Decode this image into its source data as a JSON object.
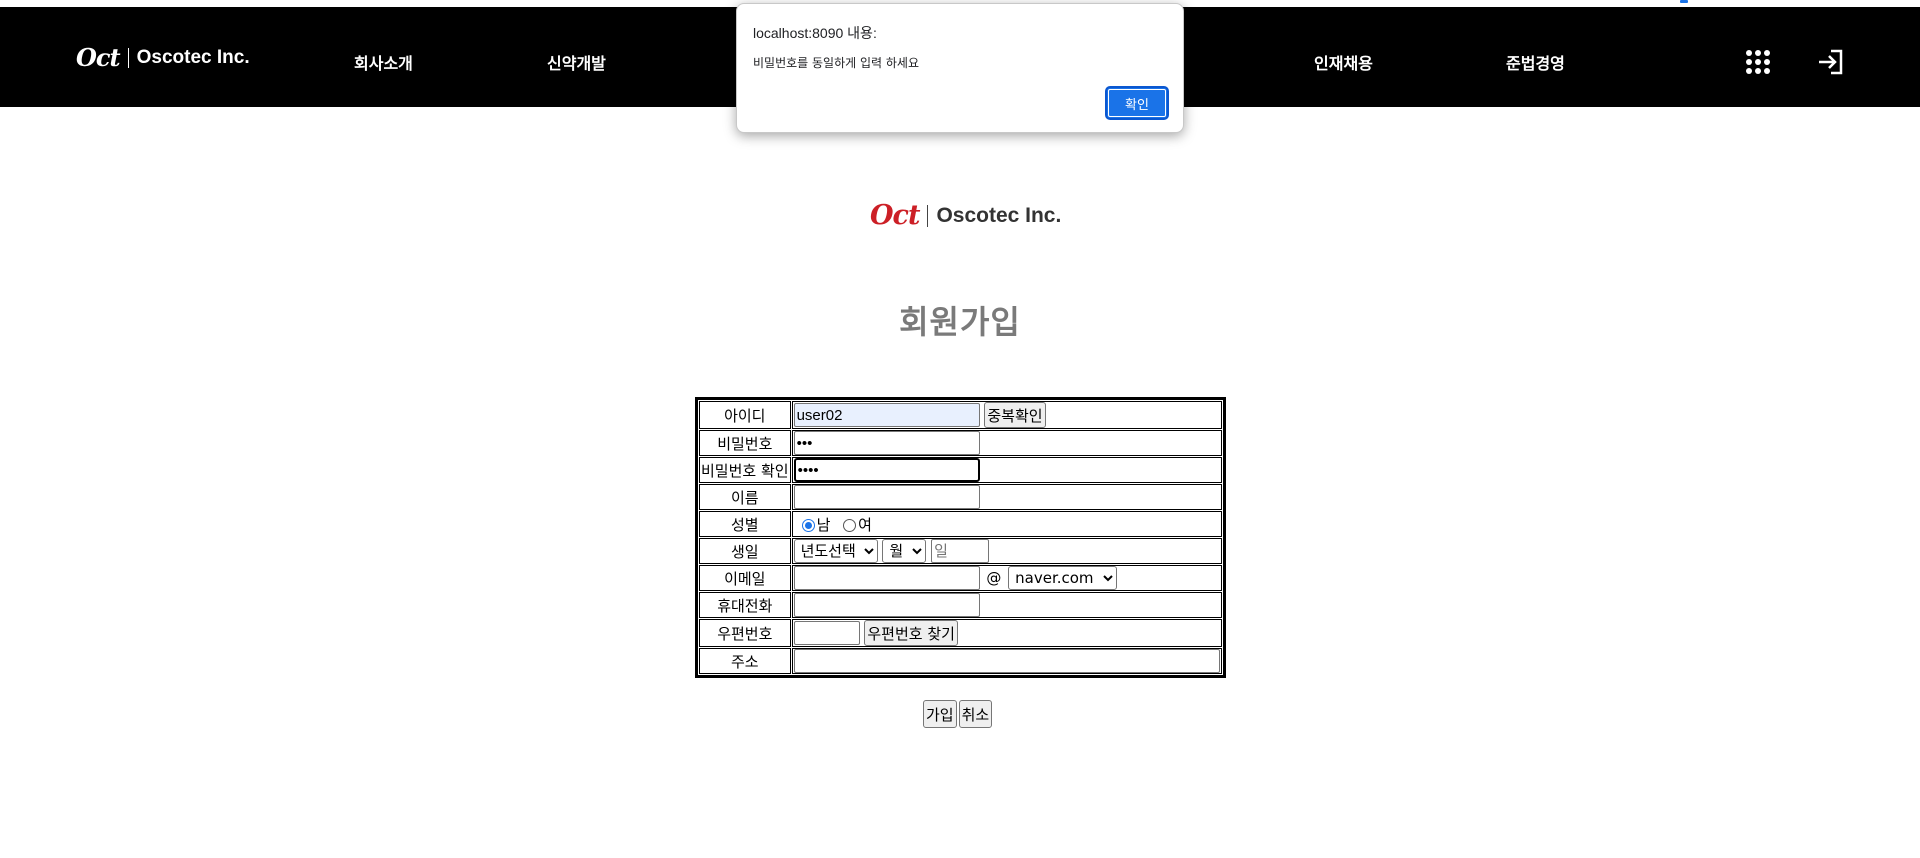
{
  "header": {
    "logo_mark": "Oct",
    "logo_name": "Oscotec Inc.",
    "nav": [
      "회사소개",
      "신약개발",
      "인재채용",
      "준법경영"
    ]
  },
  "dialog": {
    "title": "localhost:8090 내용:",
    "message": "비밀번호를 동일하게 입력 하세요",
    "ok_label": "확인"
  },
  "brand": {
    "logo_mark": "Oct",
    "logo_name": "Oscotec Inc.",
    "accent_color": "#cc1f26"
  },
  "page": {
    "title": "회원가입"
  },
  "form": {
    "labels": {
      "id": "아이디",
      "password": "비밀번호",
      "password_confirm": "비밀번호 확인",
      "name": "이름",
      "gender": "성별",
      "birthday": "생일",
      "email": "이메일",
      "phone": "휴대전화",
      "postcode": "우편번호",
      "address": "주소"
    },
    "values": {
      "id": "user02",
      "password": "•••",
      "password_confirm": "••••",
      "name": "",
      "email_user": "",
      "phone": "",
      "postcode": "",
      "address": ""
    },
    "dup_check_label": "중복확인",
    "gender_male": "남",
    "gender_female": "여",
    "gender_selected": "남",
    "birth_year_selected": "년도선택",
    "birth_month_selected": "월",
    "birth_day_placeholder": "일",
    "email_at": "@",
    "email_domain_selected": "naver.com",
    "postcode_search_label": "우편번호 찾기"
  },
  "actions": {
    "submit_label": "가입",
    "cancel_label": "취소"
  },
  "colors": {
    "header_bg": "#000000",
    "dialog_button": "#1a73e8",
    "title_gray": "#7a7a7a"
  }
}
